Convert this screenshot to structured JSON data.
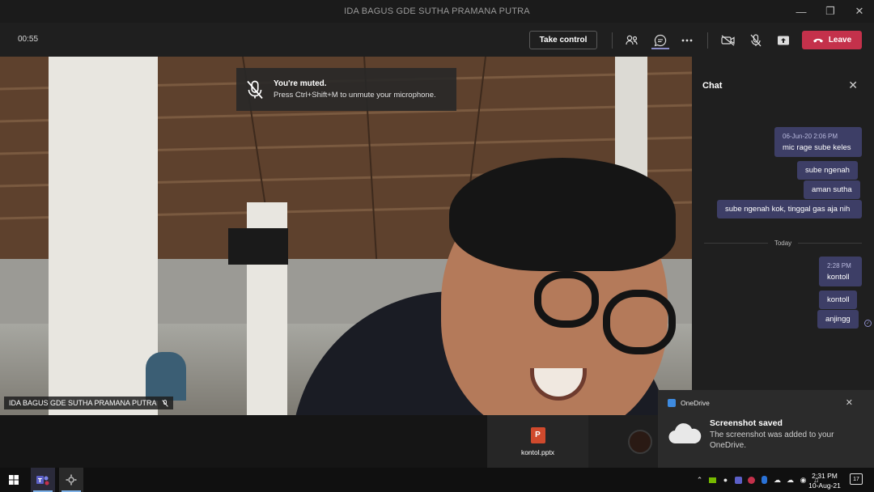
{
  "window": {
    "title": "IDA BAGUS GDE SUTHA PRAMANA PUTRA"
  },
  "toolbar": {
    "timer": "00:55",
    "take_control_label": "Take control",
    "leave_label": "Leave"
  },
  "video": {
    "muted_title": "You're muted.",
    "muted_body": "Press Ctrl+Shift+M to unmute your microphone.",
    "participant_name": "IDA BAGUS GDE SUTHA PRAMANA PUTRA"
  },
  "chat": {
    "title": "Chat",
    "messages": [
      {
        "timestamp": "06-Jun-20 2:06 PM",
        "text": "mic rage sube keles"
      },
      {
        "text": "sube ngenah"
      },
      {
        "text": "aman sutha"
      },
      {
        "text": "sube ngenah kok, tinggal gas aja nih"
      },
      {
        "timestamp": "2:28 PM",
        "text": "kontoll"
      },
      {
        "text": "kontoll"
      },
      {
        "text": "anjingg"
      }
    ],
    "separator": "Today"
  },
  "share": {
    "file_name": "kontol.pptx",
    "file_icon_letter": "P"
  },
  "toast": {
    "app": "OneDrive",
    "title": "Screenshot saved",
    "body": "The screenshot was added to your OneDrive."
  },
  "taskbar": {
    "time": "2:31 PM",
    "date": "10-Aug-21",
    "notifications": "17"
  },
  "colors": {
    "leave": "#c4314b",
    "chat_bubble": "#3d3e66",
    "accent": "#8b8cc7"
  }
}
